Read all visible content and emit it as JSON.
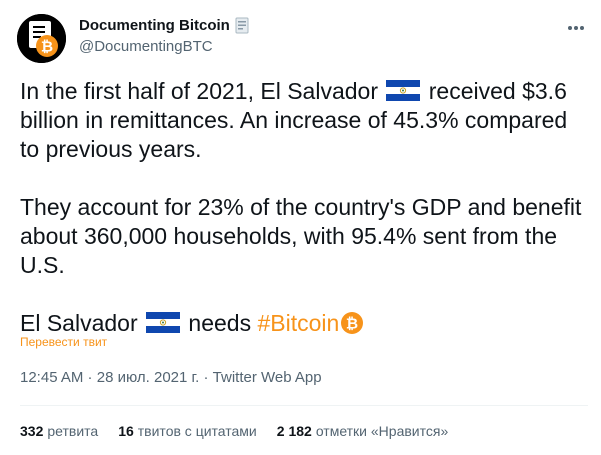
{
  "author": {
    "name": "Documenting Bitcoin",
    "handle": "@DocumentingBTC",
    "avatar_icon": "bitcoin-document-icon",
    "badge_icon": "document-icon"
  },
  "tweet": {
    "p1_before_flag": "In the first half of 2021, El Salvador",
    "p1_after_flag": "received $3.6 billion in remittances. An increase of 45.3% compared to previous years.",
    "p2": "They account for 23% of the country's GDP and benefit about 360,000 households, with 95.4% sent from the U.S.",
    "p3_before_flag": "El Salvador",
    "p3_after_flag": "needs",
    "hashtag": "#Bitcoin"
  },
  "translate_label": "Перевести твит",
  "meta": {
    "time": "12:45 AM",
    "date": "28 июл. 2021 г.",
    "source": "Twitter Web App",
    "sep": " · "
  },
  "stats": {
    "retweets_count": "332",
    "retweets_label": "ретвита",
    "quotes_count": "16",
    "quotes_label": "твитов с цитатами",
    "likes_count": "2 182",
    "likes_label": "отметки «Нравится»"
  },
  "colors": {
    "accent": "#f7931a",
    "text": "#0f1419",
    "secondary": "#536471",
    "flag_blue": "#0f47af"
  }
}
